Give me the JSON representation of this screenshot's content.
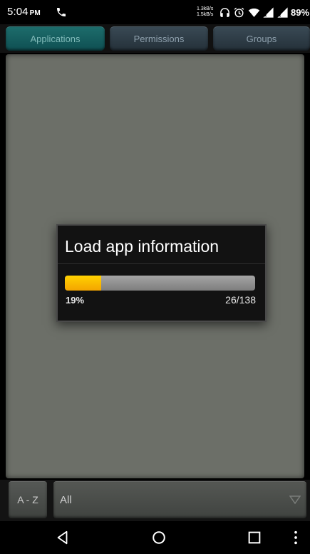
{
  "status_bar": {
    "time": "5:04",
    "ampm": "PM",
    "net_speed_up": "1.3kB/s",
    "net_speed_down": "1.5kB/s",
    "battery": "89%",
    "icons": [
      "phone-icon",
      "headphones-icon",
      "alarm-icon",
      "wifi-icon",
      "signal-icon",
      "signal-icon-2"
    ]
  },
  "tabs": [
    {
      "label": "Applications",
      "active": true
    },
    {
      "label": "Permissions",
      "active": false
    },
    {
      "label": "Groups",
      "active": false
    }
  ],
  "dialog": {
    "title": "Load app information",
    "progress_fraction": 0.19,
    "percent_label": "19%",
    "count_label": "26/138"
  },
  "bottom": {
    "sort_label": "A - Z",
    "filter_value": "All"
  },
  "nav": {
    "icons": [
      "back-icon",
      "home-icon",
      "recents-icon",
      "menu-icon"
    ]
  },
  "colors": {
    "accent": "#1d6d6c",
    "progress": "#ffc300",
    "content_bg": "#6c6f68"
  }
}
